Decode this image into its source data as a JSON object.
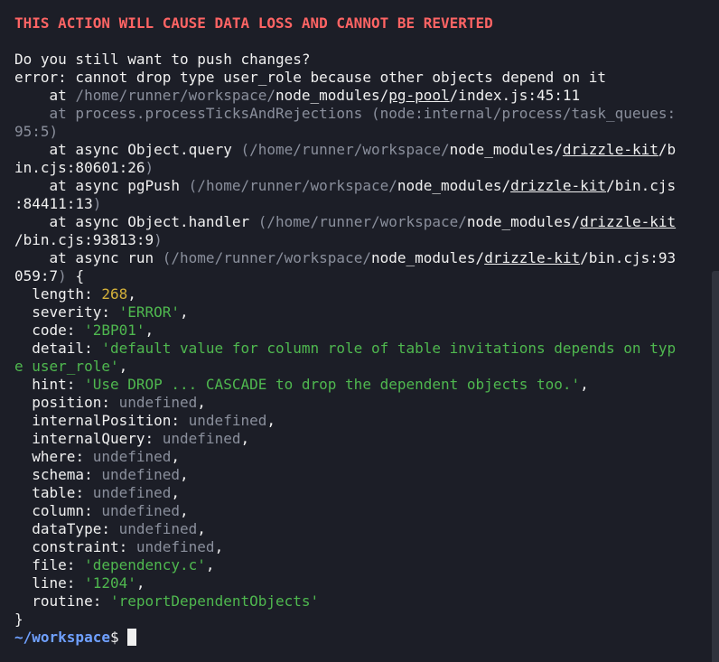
{
  "warning": "THIS ACTION WILL CAUSE DATA LOSS AND CANNOT BE REVERTED",
  "question": "Do you still want to push changes?",
  "error_line": "error: cannot drop type user_role because other objects depend on it",
  "stack": {
    "at": "at ",
    "at_async": "at async ",
    "home_prefix": "/home/runner/workspace/",
    "paren_home": "(/home/runner/workspace/",
    "node_modules": "node_modules",
    "slash": "/",
    "pg_pool": "pg-pool",
    "pg_pool_tail": "/index.js:45:11",
    "process_line1": "at process.processTicksAndRejections (node:internal/process/task_queues:",
    "process_line2": "95:5)",
    "f1_name": "Object.query ",
    "f1_pkg": "drizzle-kit",
    "f1_tail1": "/b",
    "f1_tail2": "in.cjs:80601:26",
    "f1_close": ")",
    "f2_name": "pgPush ",
    "f2_pkg": "drizzle-kit",
    "f2_tail1": "/bin.cjs",
    "f2_tail2": ":84411:13",
    "f2_close": ")",
    "f3_name": "Object.handler ",
    "f3_pkg": "drizzle-kit",
    "f3_tail1": "/bin.cjs:93813:9",
    "f3_close": ")",
    "f4_name": "run ",
    "f4_pkg": "drizzle-kit",
    "f4_tail1": "/bin.cjs:93",
    "f4_tail2": "059:7",
    "f4_close": ")",
    "open_brace": " {"
  },
  "props": {
    "length_key": "length",
    "length_val": "268",
    "severity_key": "severity",
    "severity_val": "'ERROR'",
    "code_key": "code",
    "code_val": "'2BP01'",
    "detail_key": "detail",
    "detail_val1": "'default value for column role of table invitations depends on typ",
    "detail_val2": "e user_role'",
    "hint_key": "hint",
    "hint_val": "'Use DROP ... CASCADE to drop the dependent objects too.'",
    "position_key": "position",
    "internalPosition_key": "internalPosition",
    "internalQuery_key": "internalQuery",
    "where_key": "where",
    "schema_key": "schema",
    "table_key": "table",
    "column_key": "column",
    "dataType_key": "dataType",
    "constraint_key": "constraint",
    "file_key": "file",
    "file_val": "'dependency.c'",
    "line_key": "line",
    "line_val": "'1204'",
    "routine_key": "routine",
    "routine_val": "'reportDependentObjects'",
    "undefined": "undefined",
    "colon": ": ",
    "comma": ",",
    "close_brace": "}"
  },
  "prompt": {
    "path": "~/workspace",
    "symbol": "$"
  },
  "colors": {
    "background": "#1c1e27",
    "warning": "#ff6464",
    "number": "#d4b13a",
    "string": "#4fb84f",
    "dim": "#8a8f9c",
    "prompt": "#6fa0ff"
  }
}
